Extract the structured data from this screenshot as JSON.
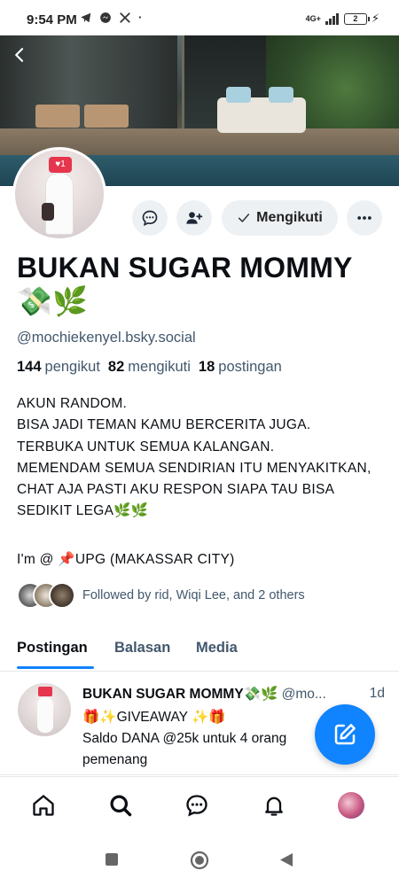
{
  "status_bar": {
    "time": "9:54 PM",
    "network": "4G+",
    "battery": "2"
  },
  "profile": {
    "display_name": "BUKAN SUGAR MOMMY 💸🌿",
    "handle": "@mochiekenyel.bsky.social",
    "stats": {
      "followers_count": "144",
      "followers_label": "pengikut",
      "following_count": "82",
      "following_label": "mengikuti",
      "posts_count": "18",
      "posts_label": "postingan"
    },
    "bio": "AKUN RANDOM.\nBISA JADI TEMAN KAMU BERCERITA JUGA.\nTERBUKA UNTUK SEMUA KALANGAN.\nMEMENDAM SEMUA SENDIRIAN ITU MENYAKITKAN, CHAT AJA PASTI AKU RESPON SIAPA TAU BISA SEDIKIT LEGA🌿🌿",
    "location": "I'm @ 📌UPG (MAKASSAR CITY)",
    "followed_by": "Followed by rid, Wiqi Lee, and 2 others"
  },
  "actions": {
    "following_label": "Mengikuti"
  },
  "tabs": [
    {
      "label": "Postingan",
      "active": true
    },
    {
      "label": "Balasan",
      "active": false
    },
    {
      "label": "Media",
      "active": false
    }
  ],
  "post": {
    "author": "BUKAN SUGAR MOMMY💸🌿",
    "handle": "@mo...",
    "time": "1d",
    "text": "🎁✨GIVEAWAY ✨🎁\nSaldo DANA @25k untuk 4 orang\npemenang"
  },
  "icons": {
    "back": "back-arrow-icon",
    "message": "chat-bubble-icon",
    "add_person": "person-add-icon",
    "check": "check-icon",
    "more": "more-horizontal-icon",
    "compose": "compose-icon",
    "home": "home-icon",
    "search": "search-icon",
    "chat": "chat-icon",
    "notifications": "bell-icon"
  },
  "colors": {
    "accent": "#1083fe",
    "muted_text": "#42576c",
    "button_bg": "#eef1f4"
  }
}
